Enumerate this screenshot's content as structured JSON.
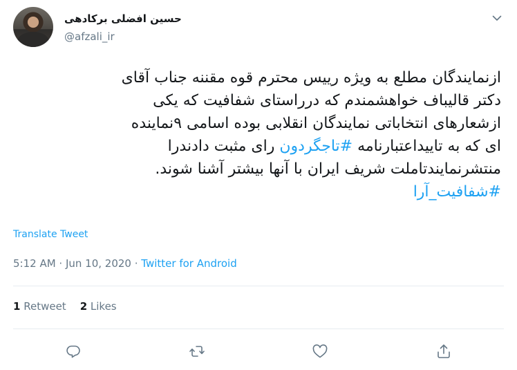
{
  "tweet": {
    "author_name": "حسین افضلی برکادهی",
    "handle": "@afzali_ir",
    "body_lines": [
      "ازنمایندگان مطلع به ویژه رییس محترم قوه مقننه جناب آقای",
      "دکتر قالیباف خواهشمندم که درراستای شفافیت که یکی",
      "ازشعارهای انتخاباتی نمایندگان انقلابی بوده اسامی ۹نماینده",
      "منتشرنمایندتاملت شریف ایران با آنها بیشتر آشنا شوند."
    ],
    "line4": {
      "before": "ای که به تاییداعتبارنامه ",
      "hashtag": "#تاجگردون",
      "after": " رای مثبت دادندرا"
    },
    "hashtag_line": "#شفافیت_آرا",
    "translate_label": "Translate Tweet",
    "time": "5:12 AM",
    "date": "Jun 10, 2020",
    "meta_separator": " · ",
    "source": "Twitter for Android",
    "retweet_count": "1",
    "retweet_label": "Retweet",
    "like_count": "2",
    "like_label": "Likes"
  },
  "icons": {
    "caret": "chevron-down-icon",
    "reply": "reply-icon",
    "retweet": "retweet-icon",
    "like": "heart-icon",
    "share": "share-icon"
  },
  "colors": {
    "accent": "#1da1f2",
    "secondary_text": "#657786",
    "text": "#14171a",
    "divider": "#e6ecf0"
  }
}
